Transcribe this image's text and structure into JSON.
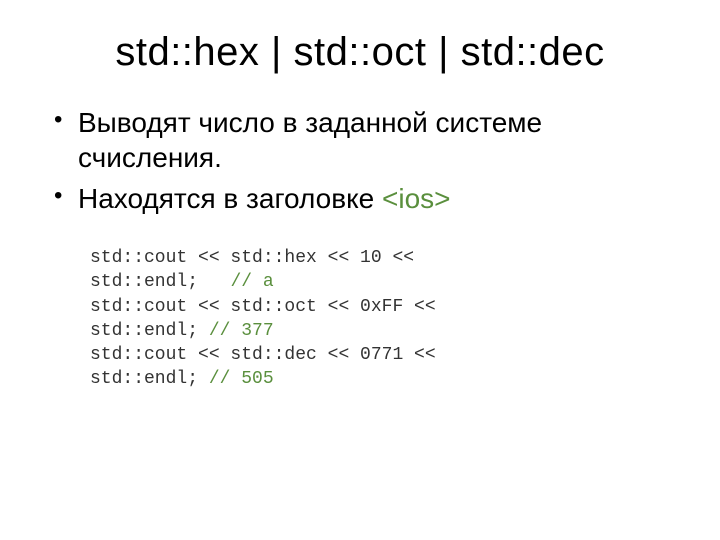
{
  "title": "std::hex | std::oct | std::dec",
  "bullets": [
    {
      "text": "Выводят число в заданной системе счисления."
    },
    {
      "text_prefix": "Находятся в заголовке ",
      "header_ref": "<ios>"
    }
  ],
  "code": {
    "l1": "std::cout << std::hex << 10 <<",
    "l2a": "std::endl;   ",
    "l2c": "// a",
    "l3": "std::cout << std::oct << 0xFF <<",
    "l4a": "std::endl; ",
    "l4c": "// 377",
    "l5": "std::cout << std::dec << 0771 <<",
    "l6a": "std::endl; ",
    "l6c": "// 505"
  }
}
